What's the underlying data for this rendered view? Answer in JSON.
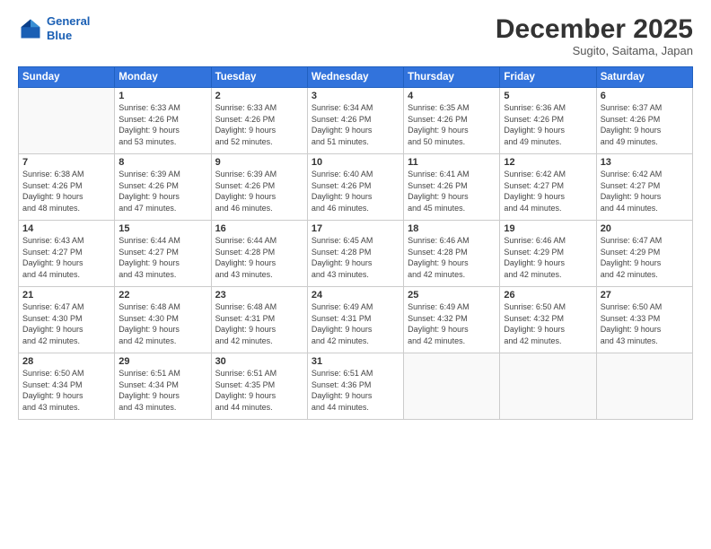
{
  "header": {
    "logo_line1": "General",
    "logo_line2": "Blue",
    "month": "December 2025",
    "location": "Sugito, Saitama, Japan"
  },
  "days_of_week": [
    "Sunday",
    "Monday",
    "Tuesday",
    "Wednesday",
    "Thursday",
    "Friday",
    "Saturday"
  ],
  "weeks": [
    [
      {
        "day": "",
        "info": ""
      },
      {
        "day": "1",
        "info": "Sunrise: 6:33 AM\nSunset: 4:26 PM\nDaylight: 9 hours\nand 53 minutes."
      },
      {
        "day": "2",
        "info": "Sunrise: 6:33 AM\nSunset: 4:26 PM\nDaylight: 9 hours\nand 52 minutes."
      },
      {
        "day": "3",
        "info": "Sunrise: 6:34 AM\nSunset: 4:26 PM\nDaylight: 9 hours\nand 51 minutes."
      },
      {
        "day": "4",
        "info": "Sunrise: 6:35 AM\nSunset: 4:26 PM\nDaylight: 9 hours\nand 50 minutes."
      },
      {
        "day": "5",
        "info": "Sunrise: 6:36 AM\nSunset: 4:26 PM\nDaylight: 9 hours\nand 49 minutes."
      },
      {
        "day": "6",
        "info": "Sunrise: 6:37 AM\nSunset: 4:26 PM\nDaylight: 9 hours\nand 49 minutes."
      }
    ],
    [
      {
        "day": "7",
        "info": "Sunrise: 6:38 AM\nSunset: 4:26 PM\nDaylight: 9 hours\nand 48 minutes."
      },
      {
        "day": "8",
        "info": "Sunrise: 6:39 AM\nSunset: 4:26 PM\nDaylight: 9 hours\nand 47 minutes."
      },
      {
        "day": "9",
        "info": "Sunrise: 6:39 AM\nSunset: 4:26 PM\nDaylight: 9 hours\nand 46 minutes."
      },
      {
        "day": "10",
        "info": "Sunrise: 6:40 AM\nSunset: 4:26 PM\nDaylight: 9 hours\nand 46 minutes."
      },
      {
        "day": "11",
        "info": "Sunrise: 6:41 AM\nSunset: 4:26 PM\nDaylight: 9 hours\nand 45 minutes."
      },
      {
        "day": "12",
        "info": "Sunrise: 6:42 AM\nSunset: 4:27 PM\nDaylight: 9 hours\nand 44 minutes."
      },
      {
        "day": "13",
        "info": "Sunrise: 6:42 AM\nSunset: 4:27 PM\nDaylight: 9 hours\nand 44 minutes."
      }
    ],
    [
      {
        "day": "14",
        "info": "Sunrise: 6:43 AM\nSunset: 4:27 PM\nDaylight: 9 hours\nand 44 minutes."
      },
      {
        "day": "15",
        "info": "Sunrise: 6:44 AM\nSunset: 4:27 PM\nDaylight: 9 hours\nand 43 minutes."
      },
      {
        "day": "16",
        "info": "Sunrise: 6:44 AM\nSunset: 4:28 PM\nDaylight: 9 hours\nand 43 minutes."
      },
      {
        "day": "17",
        "info": "Sunrise: 6:45 AM\nSunset: 4:28 PM\nDaylight: 9 hours\nand 43 minutes."
      },
      {
        "day": "18",
        "info": "Sunrise: 6:46 AM\nSunset: 4:28 PM\nDaylight: 9 hours\nand 42 minutes."
      },
      {
        "day": "19",
        "info": "Sunrise: 6:46 AM\nSunset: 4:29 PM\nDaylight: 9 hours\nand 42 minutes."
      },
      {
        "day": "20",
        "info": "Sunrise: 6:47 AM\nSunset: 4:29 PM\nDaylight: 9 hours\nand 42 minutes."
      }
    ],
    [
      {
        "day": "21",
        "info": "Sunrise: 6:47 AM\nSunset: 4:30 PM\nDaylight: 9 hours\nand 42 minutes."
      },
      {
        "day": "22",
        "info": "Sunrise: 6:48 AM\nSunset: 4:30 PM\nDaylight: 9 hours\nand 42 minutes."
      },
      {
        "day": "23",
        "info": "Sunrise: 6:48 AM\nSunset: 4:31 PM\nDaylight: 9 hours\nand 42 minutes."
      },
      {
        "day": "24",
        "info": "Sunrise: 6:49 AM\nSunset: 4:31 PM\nDaylight: 9 hours\nand 42 minutes."
      },
      {
        "day": "25",
        "info": "Sunrise: 6:49 AM\nSunset: 4:32 PM\nDaylight: 9 hours\nand 42 minutes."
      },
      {
        "day": "26",
        "info": "Sunrise: 6:50 AM\nSunset: 4:32 PM\nDaylight: 9 hours\nand 42 minutes."
      },
      {
        "day": "27",
        "info": "Sunrise: 6:50 AM\nSunset: 4:33 PM\nDaylight: 9 hours\nand 43 minutes."
      }
    ],
    [
      {
        "day": "28",
        "info": "Sunrise: 6:50 AM\nSunset: 4:34 PM\nDaylight: 9 hours\nand 43 minutes."
      },
      {
        "day": "29",
        "info": "Sunrise: 6:51 AM\nSunset: 4:34 PM\nDaylight: 9 hours\nand 43 minutes."
      },
      {
        "day": "30",
        "info": "Sunrise: 6:51 AM\nSunset: 4:35 PM\nDaylight: 9 hours\nand 44 minutes."
      },
      {
        "day": "31",
        "info": "Sunrise: 6:51 AM\nSunset: 4:36 PM\nDaylight: 9 hours\nand 44 minutes."
      },
      {
        "day": "",
        "info": ""
      },
      {
        "day": "",
        "info": ""
      },
      {
        "day": "",
        "info": ""
      }
    ]
  ]
}
